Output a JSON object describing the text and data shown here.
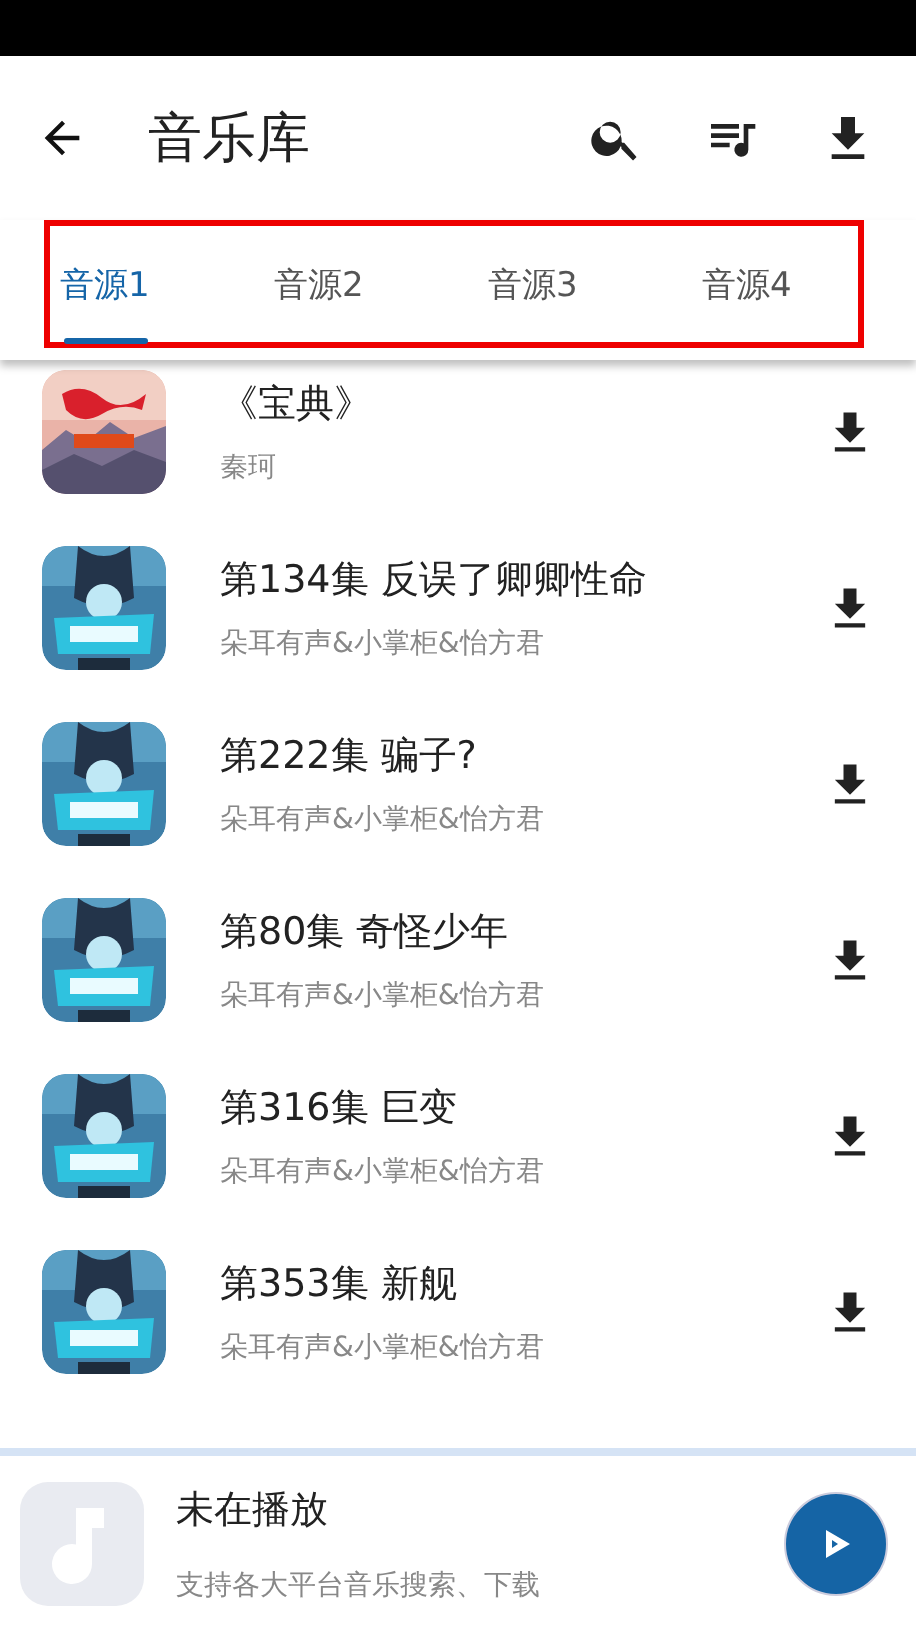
{
  "header": {
    "title": "音乐库"
  },
  "tabs_highlighted": true,
  "tabs": [
    {
      "label": "音源1",
      "selected": true
    },
    {
      "label": "音源2",
      "selected": false
    },
    {
      "label": "音源3",
      "selected": false
    },
    {
      "label": "音源4",
      "selected": false
    }
  ],
  "songs": [
    {
      "title": "《宝典》",
      "artist": "秦珂"
    },
    {
      "title": "第134集 反误了卿卿性命",
      "artist": "朵耳有声&小掌柜&怡方君"
    },
    {
      "title": "第222集  骗子?",
      "artist": "朵耳有声&小掌柜&怡方君"
    },
    {
      "title": "第80集 奇怪少年",
      "artist": "朵耳有声&小掌柜&怡方君"
    },
    {
      "title": "第316集  巨变",
      "artist": "朵耳有声&小掌柜&怡方君"
    },
    {
      "title": "第353集  新舰",
      "artist": "朵耳有声&小掌柜&怡方君"
    }
  ],
  "player": {
    "title": "未在播放",
    "subtitle": "支持各大平台音乐搜索、下载",
    "playing": false
  }
}
